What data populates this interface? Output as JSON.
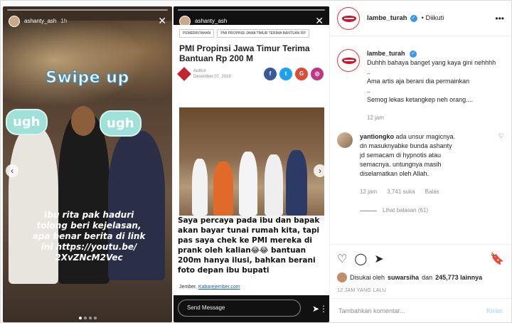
{
  "story1": {
    "username": "ashanty_ash",
    "time": "1h",
    "swipe_text": "Swipe up",
    "sticker1": "ugh",
    "sticker2": "ugh",
    "caption_lines": [
      "Ibu rita pak haduri",
      "tolong beri kejelasan,",
      "apa benar berita di link",
      "ini https://youtu.be/",
      "2XvZNcM2Vec"
    ]
  },
  "story2": {
    "username": "ashanty_ash",
    "tags": [
      "PEMERINTAHAN",
      "PMI PROPINSI JAWA TIMUR TERIMA BANTUAN RP"
    ],
    "title_lines": [
      "PMI Propinsi Jawa Timur Terima",
      "Bantuan Rp 200 M"
    ],
    "author_label": "Author",
    "date": "Desember 07, 2019",
    "caption_lines": [
      "Saya percaya pada ibu dan bapak",
      "akan bayar tunai rumah kita, tapi",
      "pas saya chek ke PMI mereka di",
      "prank oleh kalian😂😂 bantuan",
      "200m hanya ilusi, bahkan berani",
      "foto depan ibu bupati"
    ],
    "source_prefix": "Jember, ",
    "source_link": "Kabarejember.com",
    "send_placeholder": "Send Message"
  },
  "post": {
    "author": "lambe_turah",
    "follow_label": "Diikuti",
    "caption_author": "lambe_turah",
    "caption_lines": [
      "Duhhh bahaya banget yang kaya gini nehhhh",
      "..",
      "Ama artis aja berani dia permainkan",
      "..",
      "Semog lekas ketangkep neh orang...."
    ],
    "caption_time": "12 jam",
    "comment": {
      "user": "yantiongko",
      "text_lines": [
        "ada unsur magicnya.",
        "dn masuknyabke bunda ashanty",
        "jd semacam di hypnotis atau",
        "semacnya. untungnya masih",
        "diselamatkan oleh Allah."
      ],
      "time": "12 jam",
      "likes": "3,741 suka",
      "reply": "Balas",
      "view_replies": "Lihat balasan (61)"
    },
    "liked_prefix": "Disukai oleh",
    "liked_user": "suwarsiha",
    "liked_and": "dan",
    "liked_count": "245,773 lainnya",
    "ago": "12 JAM YANG LALU",
    "comment_placeholder": "Tambahkan komentar...",
    "post_button": "Kirim"
  }
}
